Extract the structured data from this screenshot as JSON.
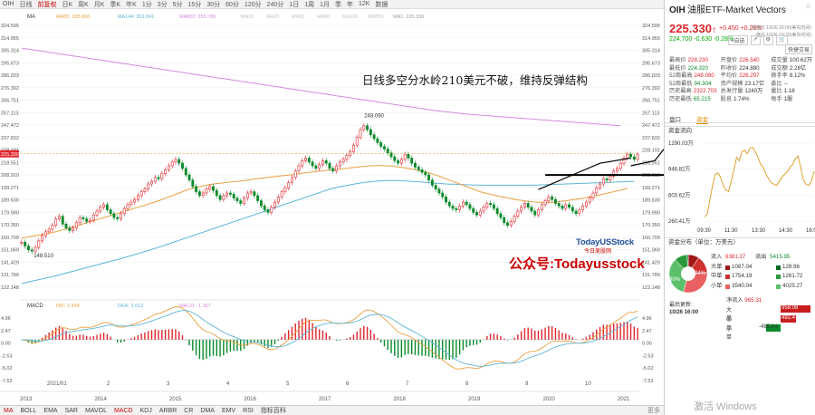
{
  "topbar": {
    "items": [
      "OIH",
      "日线",
      "前复权",
      "日K",
      "周K",
      "月K",
      "季K",
      "年K",
      "1分",
      "3分",
      "5分",
      "15分",
      "30分",
      "60分",
      "120分",
      "240分",
      "1日",
      "1周",
      "1月",
      "季",
      "年",
      "12K",
      "数据"
    ],
    "active": 2
  },
  "chart_data": {
    "type": "candlestick",
    "symbol": "OIH",
    "period": "日K",
    "ma_legend": {
      "label": "MA",
      "items": [
        {
          "name": "MA65",
          "value": "185.806",
          "color": "#e8a040"
        },
        {
          "name": "MA144",
          "value": "201.841",
          "color": "#5cb5d6"
        },
        {
          "name": "MA800",
          "value": "255.786",
          "color": "#d58ae0"
        },
        {
          "name": "MA10",
          "value": "",
          "color": "#c0c0c0"
        },
        {
          "name": "MA20",
          "value": "",
          "color": "#c0c0c0"
        },
        {
          "name": "MA30",
          "value": "",
          "color": "#c0c0c0"
        },
        {
          "name": "MA60",
          "value": "",
          "color": "#c0c0c0"
        },
        {
          "name": "MA120",
          "value": "",
          "color": "#c0c0c0"
        },
        {
          "name": "MA250",
          "value": "",
          "color": "#c0c0c0"
        },
        {
          "name": "MA1",
          "value": "225.330",
          "color": "#999"
        }
      ]
    },
    "y_ticks_left": [
      "324.595",
      "314.955",
      "305.314",
      "295.673",
      "286.033",
      "276.392",
      "266.751",
      "257.113",
      "247.472",
      "237.832",
      "228.191",
      "218.551",
      "208.910",
      "199.271",
      "189.630",
      "179.990",
      "170.350",
      "160.709",
      "151.069",
      "141.429",
      "131.789",
      "122.148"
    ],
    "y_ticks_right": [
      "324.595",
      "314.955",
      "305.314",
      "295.673",
      "286.033",
      "276.392",
      "266.751",
      "257.113",
      "247.472",
      "237.832",
      "228.191",
      "218.551",
      "208.910",
      "199.271",
      "189.630",
      "179.990",
      "170.350",
      "160.709",
      "151.069",
      "141.429",
      "131.789",
      "122.148"
    ],
    "current_price_label": "225.330",
    "y_range": [
      122.148,
      324.595
    ],
    "high_label": "248.090",
    "low_label": "148.510",
    "annotation": "日线多空分水岭210美元不破，维持反弹结构",
    "month_labels": [
      "2021/01",
      "2",
      "3",
      "4",
      "5",
      "6",
      "7",
      "8",
      "9",
      "10"
    ],
    "year_axis": [
      "2013",
      "2014",
      "2015",
      "2016",
      "2017",
      "2018",
      "2019",
      "2020",
      "2021"
    ],
    "ohlc_closes": [
      157,
      154,
      151,
      150,
      153,
      158,
      162,
      165,
      167,
      170,
      175,
      177,
      171,
      168,
      166,
      168,
      172,
      176,
      175,
      173,
      174,
      178,
      181,
      184,
      186,
      182,
      179,
      176,
      175,
      179,
      183,
      186,
      188,
      190,
      193,
      196,
      198,
      202,
      204,
      207,
      206,
      210,
      213,
      216,
      219,
      221,
      218,
      214,
      209,
      205,
      200,
      196,
      193,
      195,
      198,
      200,
      197,
      193,
      190,
      193,
      195,
      194,
      191,
      189,
      187,
      191,
      195,
      196,
      193,
      189,
      185,
      182,
      180,
      184,
      188,
      192,
      196,
      199,
      203,
      207,
      212,
      216,
      220,
      222,
      219,
      216,
      214,
      217,
      220,
      218,
      214,
      212,
      216,
      219,
      221,
      224,
      227,
      232,
      238,
      244,
      247,
      244,
      240,
      237,
      234,
      231,
      229,
      226,
      223,
      220,
      218,
      221,
      225,
      222,
      218,
      215,
      213,
      211,
      209,
      205,
      201,
      198,
      195,
      192,
      188,
      185,
      183,
      182,
      185,
      188,
      186,
      183,
      180,
      178,
      181,
      184,
      187,
      186,
      183,
      179,
      176,
      172,
      170,
      173,
      177,
      181,
      184,
      187,
      184,
      181,
      178,
      182,
      186,
      189,
      192,
      190,
      187,
      185,
      183,
      186,
      184,
      181,
      179,
      182,
      185,
      188,
      191,
      195,
      199,
      202,
      206,
      205,
      208,
      212,
      214,
      218,
      222,
      225,
      223,
      221,
      225
    ],
    "ma65": [
      160,
      160.5,
      161,
      161.5,
      162,
      162.5,
      163,
      163.5,
      164,
      164.5,
      165,
      165.8,
      166.5,
      167.2,
      168,
      168.8,
      169.6,
      170.4,
      171.2,
      172,
      172.8,
      173.6,
      174.4,
      175.2,
      176,
      176.8,
      177.6,
      178.4,
      179.2,
      180,
      180.8,
      181.6,
      182.4,
      183.2,
      184,
      184.8,
      185.6,
      186.4,
      187.2,
      188,
      189,
      190,
      191,
      192,
      193,
      194,
      195,
      196,
      197,
      198,
      198.8,
      199.4,
      200,
      200.5,
      201,
      201.5,
      202,
      202.3,
      202.6,
      202.9,
      203.2,
      203.5,
      203.8,
      204,
      204.3,
      204.6,
      205,
      205.4,
      205.8,
      206.2,
      206.5,
      206.8,
      207.1,
      207.4,
      207.7,
      208,
      208.3,
      208.6,
      208.9,
      209.2,
      209.5,
      209.8,
      210.2,
      210.6,
      211,
      211.3,
      211.6,
      211.9,
      212.2,
      212.5,
      212.8,
      213,
      213.2,
      213.5,
      213.8,
      214.1,
      214.4,
      214.7,
      215,
      215.3,
      215.6,
      215.8,
      216,
      216.1,
      216.2,
      216.2,
      216.1,
      216,
      215.8,
      215.5,
      215.2,
      214.8,
      214.4,
      214,
      213.5,
      213,
      212.5,
      212,
      211.3,
      210.5,
      209.7,
      208.9,
      208,
      207,
      206,
      205,
      204,
      203,
      202,
      201,
      200,
      199,
      198,
      197,
      196,
      195.3,
      194.6,
      194,
      193.4,
      192.8,
      192.2,
      191.7,
      191.2,
      190.7,
      190.2,
      189.7,
      189.3,
      188.9,
      188.6,
      188.3,
      188.1,
      187.9,
      187.8,
      187.7,
      187.7,
      187.8,
      188,
      188.3,
      188.6,
      189,
      189.4,
      189.8,
      190.2,
      190.6,
      191,
      191.5,
      192,
      192.5,
      193,
      193.6,
      194.2,
      194.8,
      195.4,
      196,
      196.6,
      197.2,
      197.8,
      198.4
    ],
    "ma144": [
      125,
      125.6,
      126.2,
      126.8,
      127.4,
      128,
      128.6,
      129.2,
      129.8,
      130.4,
      131,
      131.7,
      132.4,
      133.1,
      133.8,
      134.5,
      135.2,
      135.9,
      136.6,
      137.3,
      138,
      138.7,
      139.4,
      140.1,
      140.8,
      141.5,
      142.2,
      142.9,
      143.6,
      144.3,
      145,
      145.8,
      146.6,
      147.4,
      148.2,
      149,
      149.8,
      150.6,
      151.4,
      152.2,
      153,
      153.9,
      154.8,
      155.7,
      156.6,
      157.5,
      158.4,
      159.3,
      160.2,
      161.1,
      162,
      162.9,
      163.8,
      164.7,
      165.6,
      166.5,
      167.4,
      168.3,
      169.2,
      170.1,
      171,
      171.9,
      172.8,
      173.7,
      174.6,
      175.5,
      176.4,
      177.3,
      178.2,
      179.1,
      180,
      180.9,
      181.8,
      182.7,
      183.6,
      184.5,
      185.4,
      186.3,
      187.2,
      188.1,
      189,
      189.9,
      190.8,
      191.7,
      192.6,
      193.5,
      194.4,
      195.3,
      196.2,
      197.1,
      198,
      198.6,
      199.2,
      199.8,
      200.3,
      200.8,
      201.3,
      201.8,
      202.3,
      202.7,
      203.1,
      203.4,
      203.7,
      204,
      204.2,
      204.4,
      204.5,
      204.6,
      204.6,
      204.6,
      204.5,
      204.4,
      204.3,
      204.2,
      204,
      203.8,
      203.6,
      203.4,
      203.2,
      203,
      202.8,
      202.6,
      202.4,
      202.2,
      202,
      201.9,
      201.8,
      201.7,
      201.6,
      201.5,
      201.4,
      201.3,
      201.2,
      201.1,
      201,
      201,
      201,
      201,
      201,
      201,
      201,
      201,
      201,
      201,
      201,
      201,
      201,
      201,
      201,
      201,
      201.1,
      201.2,
      201.3,
      201.4,
      201.5,
      201.6,
      201.7,
      201.8,
      201.9,
      202,
      202.1,
      202.2,
      202.3,
      202.4,
      202.5,
      202.6,
      202.7,
      202.8,
      202.9,
      203,
      203.1,
      203.2,
      203.3,
      203.4,
      203.5,
      203.6,
      203.7,
      203.8,
      203.9,
      204
    ],
    "ma800": [
      307,
      306.6,
      306.2,
      305.8,
      305.4,
      305,
      304.6,
      304.2,
      303.8,
      303.4,
      303,
      302.6,
      302.2,
      301.8,
      301.4,
      301,
      300.6,
      300.2,
      299.8,
      299.4,
      299,
      298.6,
      298.2,
      297.8,
      297.4,
      297,
      296.6,
      296.2,
      295.8,
      295.4,
      295,
      294.6,
      294.2,
      293.8,
      293.4,
      293,
      292.6,
      292.2,
      291.8,
      291.4,
      291,
      290.6,
      290.2,
      289.8,
      289.4,
      289,
      288.6,
      288.2,
      287.8,
      287.4,
      287,
      286.6,
      286.2,
      285.8,
      285.4,
      285,
      284.6,
      284.2,
      283.8,
      283.4,
      283,
      282.6,
      282.2,
      281.8,
      281.4,
      281,
      280.6,
      280.2,
      279.8,
      279.4,
      279,
      278.6,
      278.2,
      277.8,
      277.4,
      277,
      276.6,
      276.2,
      275.8,
      275.4,
      275,
      274.6,
      274.2,
      273.8,
      273.4,
      273,
      272.6,
      272.2,
      271.8,
      271.4,
      271,
      270.6,
      270.2,
      269.8,
      269.4,
      269,
      268.6,
      268.2,
      267.8,
      267.4,
      267,
      266.6,
      266.2,
      265.8,
      265.4,
      265,
      264.6,
      264.2,
      263.8,
      263.4,
      263,
      262.6,
      262.2,
      261.8,
      261.4,
      261,
      260.6,
      260.2,
      259.8,
      259.4,
      259,
      258.7,
      258.4,
      258.1,
      257.8,
      257.5,
      257.2,
      256.9,
      256.6,
      256.3,
      256,
      255.8,
      255.6,
      255.4,
      255.2,
      255,
      254.8,
      254.6,
      254.4,
      254.2,
      254,
      253.8,
      253.6,
      253.4,
      253.2,
      253,
      252.8,
      252.6,
      252.4,
      252.2,
      252,
      251.8,
      251.6,
      251.4,
      251.2,
      251,
      250.8,
      250.6,
      250.4,
      250.2,
      250,
      249.8,
      249.6,
      249.4,
      249.2,
      249,
      248.8,
      248.6,
      248.4,
      248.2,
      248,
      247.8,
      247.6,
      247.4,
      247.2,
      247
    ],
    "support_level": 208.9,
    "macd_legend": {
      "label": "MACD",
      "items": [
        {
          "name": "DIF",
          "value": "2.934",
          "color": "#e8a040"
        },
        {
          "name": "DEA",
          "value": "3.612",
          "color": "#5cb5d6"
        },
        {
          "name": "MACD",
          "value": "-1.357",
          "color": "#d58ae0"
        }
      ]
    },
    "macd_ticks": [
      "4.96",
      "2.47",
      "0.00",
      "-2.53",
      "-5.02",
      "-7.52"
    ],
    "macd_ticks_right": [
      "4.96",
      "2.47",
      "0.00",
      "-2.53",
      "-5.02",
      "-7.52"
    ],
    "macd_range": [
      -8.5,
      6
    ]
  },
  "watermark": {
    "brand": "TodayUSStock",
    "sub": "今日美股网",
    "wechat": "公众号:Todayusstock"
  },
  "bottombar": {
    "items": [
      "MA",
      "BOLL",
      "EMA",
      "SAR",
      "MAVOL",
      "MACD",
      "KDJ",
      "ARBR",
      "CR",
      "DMA",
      "EMV",
      "RSI",
      "指标百科"
    ],
    "active": [
      0,
      5
    ],
    "more": "更多"
  },
  "side": {
    "ticker": "OIH",
    "name": "油服ETF-Market Vectors",
    "star": "☆",
    "price": "225.330",
    "arrow": "↑",
    "change": "+0.450",
    "change_pct": "+0.20%",
    "time1": "收盘价 10/26 16:00(美东时间)",
    "time2": "盘后 10/26 19:23(美东时间)",
    "after_hours": "224.700",
    "ah_change": "-0.630",
    "ah_pct": "-0.28%",
    "btns": [
      "+自选",
      "↗",
      "⚙",
      "🛒"
    ],
    "btn2": "快捷交易",
    "stats": [
      [
        [
          "最高价",
          "228.230",
          "up"
        ],
        [
          "开盘价",
          "226.540",
          "up"
        ],
        [
          "成交量",
          "100.62万",
          "nt"
        ]
      ],
      [
        [
          "最低价",
          "224.320",
          "dn"
        ],
        [
          "昨收价",
          "224.880",
          "nt"
        ],
        [
          "成交额",
          "2.28亿",
          "nt"
        ]
      ],
      [
        [
          "52周最高",
          "248.090",
          "up"
        ],
        [
          "平均价",
          "226.297",
          "up"
        ],
        [
          "换手率",
          "8.12%",
          "nt"
        ]
      ],
      [
        [
          "52周最低",
          "94.304",
          "dn"
        ],
        [
          "资产规模",
          "23.17亿",
          "nt"
        ],
        [
          "委比",
          "--",
          "nt"
        ]
      ],
      [
        [
          "历史最高",
          "2322.703",
          "up"
        ],
        [
          "总发行量",
          "1240万",
          "nt"
        ],
        [
          "量比",
          "1.18",
          "nt"
        ]
      ],
      [
        [
          "历史最低",
          "65.215",
          "dn"
        ],
        [
          "股息",
          "1.74%",
          "nt"
        ],
        [
          "每手",
          "1股",
          "nt"
        ]
      ]
    ],
    "tabs": [
      "盘口",
      "资金"
    ],
    "active_tab": 1,
    "fund_flow_title": "资金流向",
    "ff_ticks": [
      "1290.03万",
      "946.82万",
      "603.62万",
      "260.41万"
    ],
    "ff_times": [
      "09:30",
      "11:30",
      "13:30",
      "14:30",
      "16:00"
    ],
    "ff_series": [
      260,
      300,
      500,
      700,
      860,
      880,
      820,
      700,
      640,
      620,
      760,
      930,
      1100,
      1050,
      1180,
      1200,
      1150,
      1230,
      1240,
      1180,
      1100,
      1000,
      960,
      860,
      800,
      740,
      720,
      700,
      760,
      820,
      860,
      900,
      960,
      1000,
      1080,
      1120,
      960,
      780,
      720,
      700,
      760,
      900
    ],
    "dist_title": "资金分布（单位：万美元）",
    "inflow": {
      "label": "流入",
      "total": "6381.27",
      "rows": [
        [
          "大单",
          "1087.04",
          "#a01818"
        ],
        [
          "中单",
          "1754.19",
          "#d03030"
        ],
        [
          "小单",
          "3540.04",
          "#e86060"
        ]
      ]
    },
    "outflow": {
      "label": "流出",
      "total": "5415.95",
      "rows": [
        [
          "",
          "128.96",
          "#0a6a20"
        ],
        [
          "",
          "1261.72",
          "#2a9a3a"
        ],
        [
          "",
          "4025.27",
          "#5cc06a"
        ]
      ]
    },
    "pie": [
      {
        "v": 1087,
        "c": "#a01818"
      },
      {
        "v": 1754,
        "c": "#d03030"
      },
      {
        "v": 3540,
        "c": "#e86060"
      },
      {
        "v": 4025,
        "c": "#5cc06a"
      },
      {
        "v": 1262,
        "c": "#2a9a3a"
      },
      {
        "v": 129,
        "c": "#0a6a20"
      }
    ],
    "pie_labels": [
      "30%",
      "34%"
    ],
    "update": "最后更新:",
    "update_time": "10/26 16:00",
    "net_label": "净流入",
    "net_value": "965.31",
    "net_rows": [
      {
        "label": "大单",
        "value": "958.08",
        "amount": 958.08
      },
      {
        "label": "中单",
        "value": "492.47",
        "amount": 492.47
      },
      {
        "label": "小单",
        "value": "-485.24",
        "amount": -485.24
      }
    ],
    "windows_wm": "激活 Windows"
  }
}
